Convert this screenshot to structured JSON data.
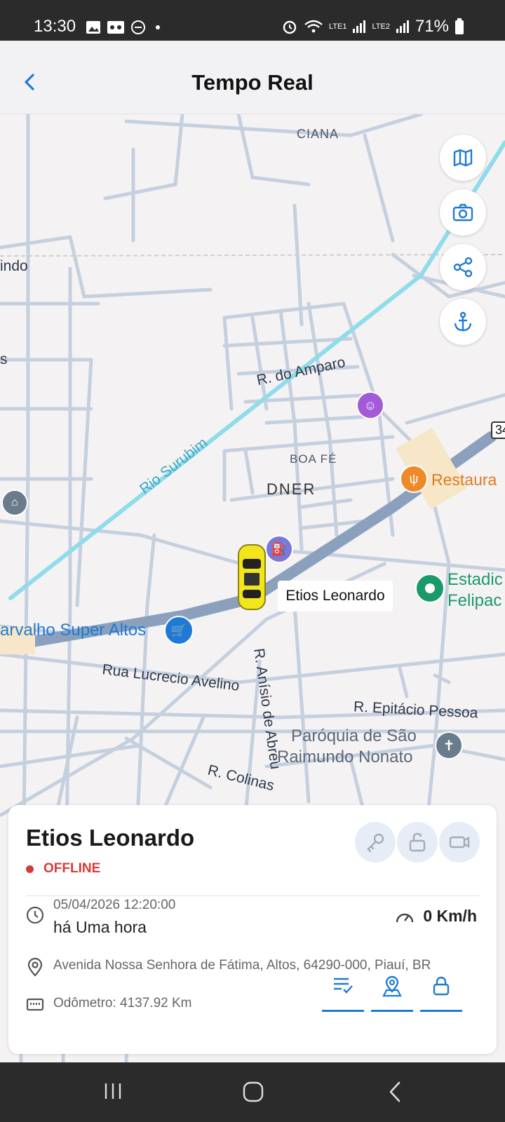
{
  "status_bar": {
    "time": "13:30",
    "network1": "LTE1",
    "network2": "LTE2",
    "battery": "71%"
  },
  "header": {
    "title": "Tempo Real",
    "back_icon": "chevron-left-icon"
  },
  "map": {
    "buttons": [
      "map-icon",
      "camera-icon",
      "share-icon",
      "anchor-icon"
    ],
    "labels": {
      "ciana": "CIANA",
      "indo": "indo",
      "s": "s",
      "amparo": "R. do Amparo",
      "rio": "Rio Surubim",
      "boafe": "BOA FÉ",
      "dner": "DNER",
      "restaurant": "Restaura",
      "estadio1": "Estadic",
      "estadio2": "Felipac",
      "super": "arvalho Super Altos",
      "lucrecio": "Rua Lucrecio Avelino",
      "anisio": "R. Anísio de Abreu",
      "epitacio": "R. Epitácio Pessoa",
      "paroquia1": "Paróquia de São",
      "paroquia2": "Raimundo Nonato",
      "colinas": "R. Colinas",
      "route": "34"
    },
    "car_label": "Etios Leonardo"
  },
  "vehicle_card": {
    "name": "Etios Leonardo",
    "status": "OFFLINE",
    "status_color": "#d63b3b",
    "datetime": "05/04/2026 12:20:00",
    "ago": "há Uma hora",
    "speed": "0 Km/h",
    "address": "Avenida Nossa Senhora de Fátima, Altos, 64290-000, Piauí, BR",
    "odometer": "Odômetro: 4137.92 Km",
    "top_actions": [
      "key-icon",
      "unlock-icon",
      "camera-device-icon"
    ],
    "bottom_actions": [
      "list-check-icon",
      "location-person-icon",
      "lock-icon"
    ],
    "accent_color": "#1f7ad6"
  }
}
